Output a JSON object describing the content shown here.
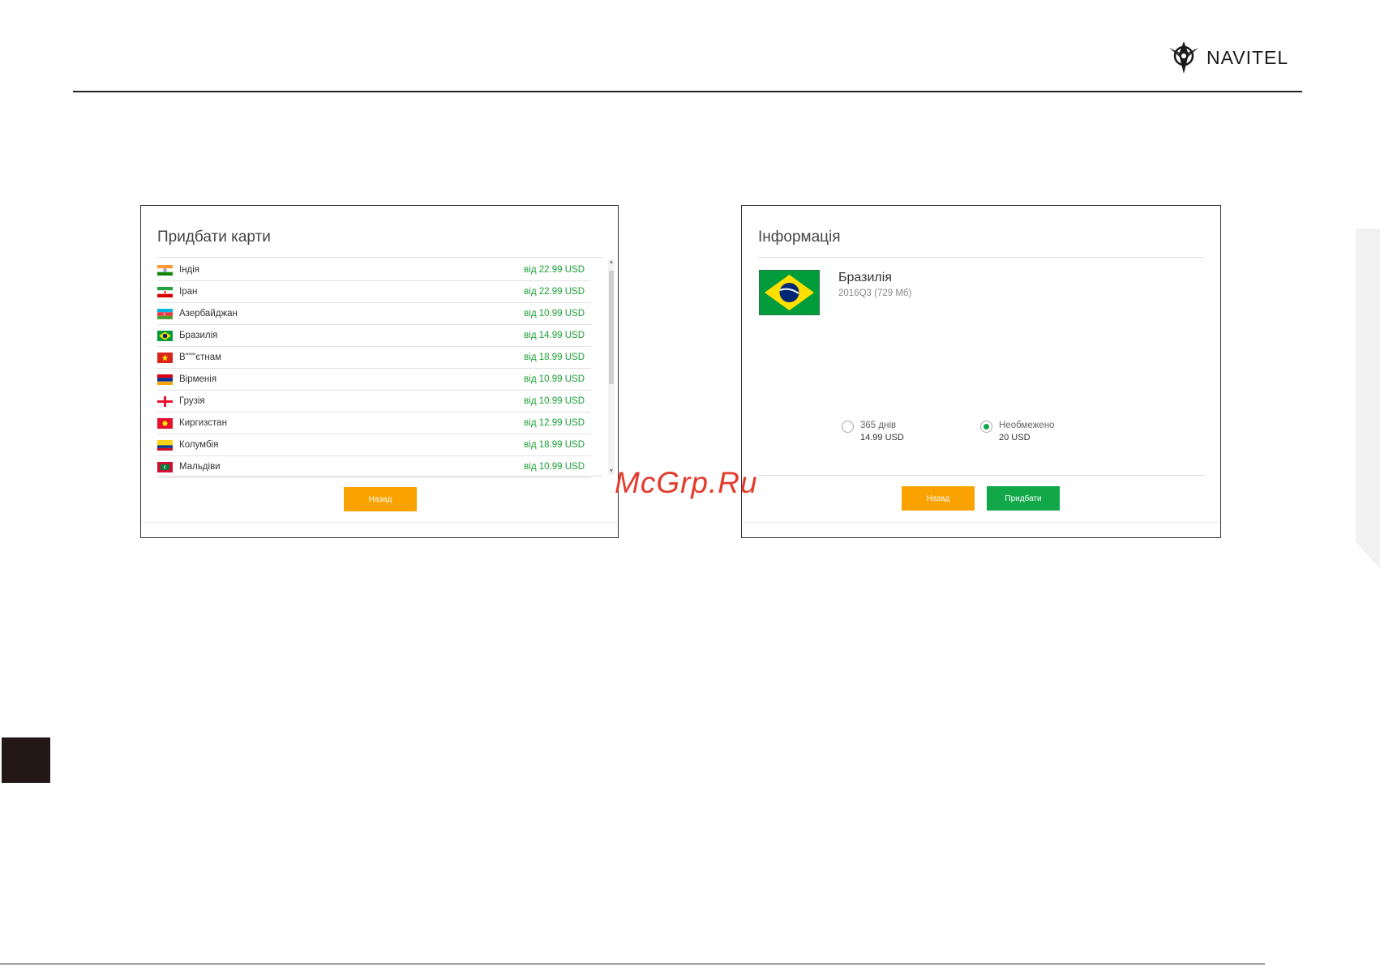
{
  "brand": {
    "name": "NAVITEL"
  },
  "watermark": "McGrp.Ru",
  "left_panel": {
    "title": "Придбати карти",
    "rows": [
      {
        "name": "Індія",
        "price": "від 22.99 USD",
        "flag": "india-flag"
      },
      {
        "name": "Іран",
        "price": "від 22.99 USD",
        "flag": "iran-flag"
      },
      {
        "name": "Азербайджан",
        "price": "від 10.99 USD",
        "flag": "azerbaijan-flag"
      },
      {
        "name": "Бразилія",
        "price": "від 14.99 USD",
        "flag": "brazil-flag"
      },
      {
        "name": "В\"'\"'єтнам",
        "price": "від 18.99 USD",
        "flag": "vietnam-flag"
      },
      {
        "name": "Вірменія",
        "price": "від 10.99 USD",
        "flag": "armenia-flag"
      },
      {
        "name": "Грузія",
        "price": "від 10.99 USD",
        "flag": "georgia-flag"
      },
      {
        "name": "Киргизстан",
        "price": "від 12.99 USD",
        "flag": "kyrgyzstan-flag"
      },
      {
        "name": "Колумбія",
        "price": "від 18.99 USD",
        "flag": "colombia-flag"
      },
      {
        "name": "Мальдіви",
        "price": "від 10.99 USD",
        "flag": "maldives-flag"
      }
    ],
    "back_label": "Назад"
  },
  "right_panel": {
    "title": "Інформація",
    "country": "Бразилія",
    "version": "2016Q3 (729 Мб)",
    "options": [
      {
        "label": "365 днів",
        "price": "14.99 USD",
        "checked": false
      },
      {
        "label": "Необмежено",
        "price": "20 USD",
        "checked": true
      }
    ],
    "back_label": "Назад",
    "buy_label": "Придбати"
  },
  "colors": {
    "price_green": "#1aa035",
    "orange": "#f9a200",
    "green": "#12a84a",
    "watermark": "#e23b2c"
  }
}
